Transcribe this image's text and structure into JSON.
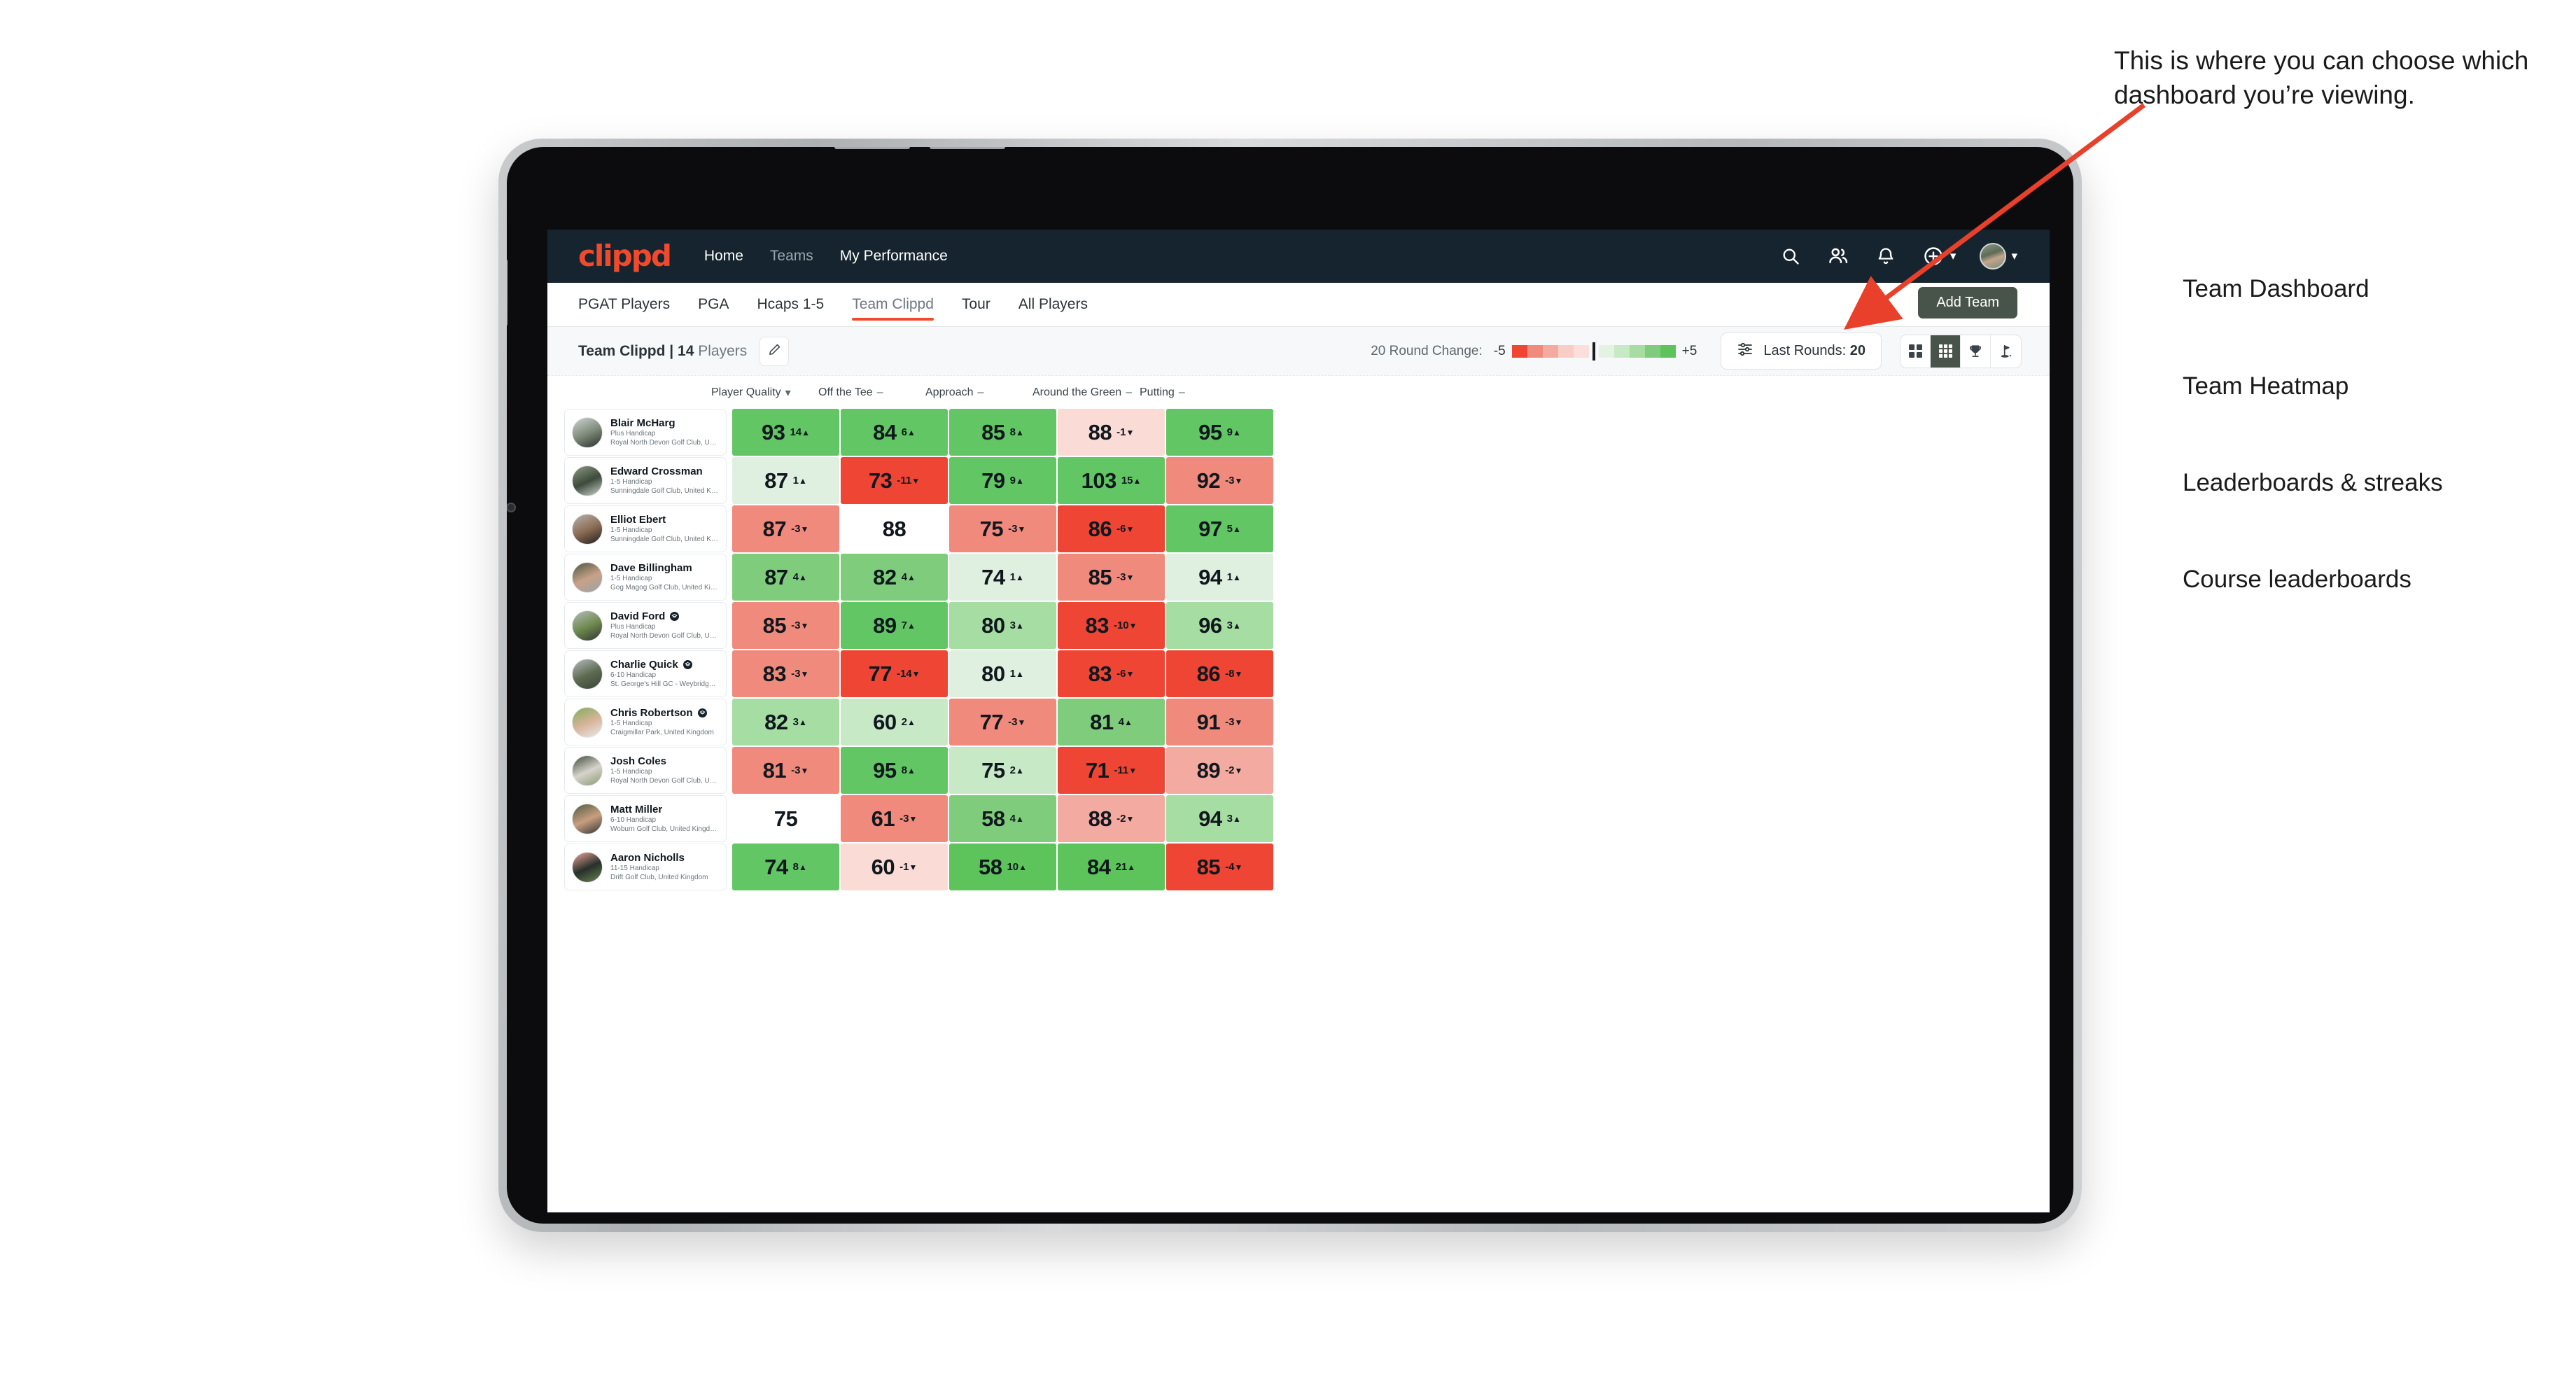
{
  "navbar": {
    "logo": "clippd",
    "links": [
      {
        "label": "Home",
        "dim": false
      },
      {
        "label": "Teams",
        "dim": true
      },
      {
        "label": "My Performance",
        "dim": false
      }
    ],
    "icons": [
      "search-icon",
      "people-icon",
      "bell-icon",
      "plus-circle-icon",
      "avatar"
    ]
  },
  "tabs": [
    {
      "label": "PGAT Players",
      "active": false
    },
    {
      "label": "PGA",
      "active": false
    },
    {
      "label": "Hcaps 1-5",
      "active": false
    },
    {
      "label": "Team Clippd",
      "active": true
    },
    {
      "label": "Tour",
      "active": false
    },
    {
      "label": "All Players",
      "active": false
    }
  ],
  "add_team_label": "Add Team",
  "toolbar": {
    "team_name": "Team Clippd",
    "separator": "|",
    "player_count": "14",
    "players_word": "Players",
    "edit_icon": "pencil-icon",
    "legend_label": "20 Round Change:",
    "legend_min": "-5",
    "legend_max": "+5",
    "rounds_icon": "filter-sliders-icon",
    "rounds_label": "Last Rounds:",
    "rounds_value": "20",
    "view_toggle": [
      {
        "name": "team-dashboard",
        "icon": "grid-4-icon",
        "active": false
      },
      {
        "name": "team-heatmap",
        "icon": "grid-9-icon",
        "active": true
      },
      {
        "name": "leaderboards-streaks",
        "icon": "trophy-icon",
        "active": false
      },
      {
        "name": "course-leaderboards",
        "icon": "golf-flag-icon",
        "active": false
      }
    ]
  },
  "columns": [
    {
      "label": "Player Quality",
      "marker": "chevron-down-icon"
    },
    {
      "label": "Off the Tee",
      "marker": "dash"
    },
    {
      "label": "Approach",
      "marker": "dash"
    },
    {
      "label": "Around the Green",
      "marker": "dash"
    },
    {
      "label": "Putting",
      "marker": "dash"
    }
  ],
  "chart_data": {
    "type": "heatmap",
    "title": "Team Clippd | 14 Players",
    "columns": [
      "Player Quality",
      "Off the Tee",
      "Approach",
      "Around the Green",
      "Putting"
    ],
    "rows": [
      "Blair McHarg",
      "Edward Crossman",
      "Elliot Ebert",
      "Dave Billingham",
      "David Ford",
      "Charlie Quick",
      "Chris Robertson",
      "Josh Coles",
      "Matt Miller",
      "Aaron Nicholls"
    ],
    "values": [
      [
        93,
        84,
        85,
        88,
        95
      ],
      [
        87,
        73,
        79,
        103,
        92
      ],
      [
        87,
        88,
        75,
        86,
        97
      ],
      [
        87,
        82,
        74,
        85,
        94
      ],
      [
        85,
        89,
        80,
        83,
        96
      ],
      [
        83,
        77,
        80,
        83,
        86
      ],
      [
        82,
        60,
        77,
        81,
        91
      ],
      [
        81,
        95,
        75,
        71,
        89
      ],
      [
        75,
        61,
        58,
        88,
        94
      ],
      [
        74,
        60,
        58,
        84,
        85
      ]
    ],
    "deltas": [
      [
        14,
        6,
        8,
        -1,
        9
      ],
      [
        1,
        -11,
        9,
        15,
        -3
      ],
      [
        -3,
        null,
        -3,
        -6,
        5
      ],
      [
        4,
        4,
        1,
        -3,
        1
      ],
      [
        -3,
        7,
        3,
        -10,
        3
      ],
      [
        -3,
        -14,
        1,
        -6,
        -8
      ],
      [
        3,
        2,
        -3,
        4,
        -3
      ],
      [
        -3,
        8,
        2,
        -11,
        -2
      ],
      [
        null,
        -3,
        4,
        -2,
        3
      ],
      [
        8,
        -1,
        10,
        21,
        -4
      ]
    ],
    "legend": {
      "min": -5,
      "max": 5,
      "label": "20 Round Change"
    },
    "colorscale": [
      "#ee4535",
      "#f08a7d",
      "#f3aaa0",
      "#f8cdc6",
      "#fbdfda",
      "#ffffff",
      "#e4f2e4",
      "#c8e9c6",
      "#a5dda2",
      "#7fcd7c",
      "#5cc45b"
    ]
  },
  "players": [
    {
      "name": "Blair McHarg",
      "verified": false,
      "handicap": "Plus Handicap",
      "club": "Royal North Devon Golf Club, United Kingdom",
      "avatar_colors": [
        "#cfd4d6",
        "#7e8a78",
        "#2a2f2c"
      ],
      "cells": [
        {
          "value": "93",
          "delta": "14",
          "dir": "up",
          "bg": "#62c665"
        },
        {
          "value": "84",
          "delta": "6",
          "dir": "up",
          "bg": "#62c665"
        },
        {
          "value": "85",
          "delta": "8",
          "dir": "up",
          "bg": "#62c665"
        },
        {
          "value": "88",
          "delta": "-1",
          "dir": "down",
          "bg": "#fadbd5"
        },
        {
          "value": "95",
          "delta": "9",
          "dir": "up",
          "bg": "#62c665"
        }
      ]
    },
    {
      "name": "Edward Crossman",
      "verified": false,
      "handicap": "1-5 Handicap",
      "club": "Sunningdale Golf Club, United Kingdom",
      "avatar_colors": [
        "#8f9b85",
        "#3d4a3c",
        "#d0d6cf"
      ],
      "cells": [
        {
          "value": "87",
          "delta": "1",
          "dir": "up",
          "bg": "#dff0e0"
        },
        {
          "value": "73",
          "delta": "-11",
          "dir": "down",
          "bg": "#ee4535"
        },
        {
          "value": "79",
          "delta": "9",
          "dir": "up",
          "bg": "#62c665"
        },
        {
          "value": "103",
          "delta": "15",
          "dir": "up",
          "bg": "#62c665"
        },
        {
          "value": "92",
          "delta": "-3",
          "dir": "down",
          "bg": "#f08a7d"
        }
      ]
    },
    {
      "name": "Elliot Ebert",
      "verified": false,
      "handicap": "1-5 Handicap",
      "club": "Sunningdale Golf Club, United Kingdom",
      "avatar_colors": [
        "#b9b3ad",
        "#8b6c55",
        "#1e1d1b"
      ],
      "cells": [
        {
          "value": "87",
          "delta": "-3",
          "dir": "down",
          "bg": "#f08a7d"
        },
        {
          "value": "88",
          "delta": "",
          "dir": "none",
          "bg": "#ffffff"
        },
        {
          "value": "75",
          "delta": "-3",
          "dir": "down",
          "bg": "#f08a7d"
        },
        {
          "value": "86",
          "delta": "-6",
          "dir": "down",
          "bg": "#ee4535"
        },
        {
          "value": "97",
          "delta": "5",
          "dir": "up",
          "bg": "#62c665"
        }
      ]
    },
    {
      "name": "Dave Billingham",
      "verified": false,
      "handicap": "1-5 Handicap",
      "club": "Gog Magog Golf Club, United Kingdom",
      "avatar_colors": [
        "#4a5442",
        "#c8a187",
        "#9aa3a8"
      ],
      "cells": [
        {
          "value": "87",
          "delta": "4",
          "dir": "up",
          "bg": "#7fcd7c"
        },
        {
          "value": "82",
          "delta": "4",
          "dir": "up",
          "bg": "#7fcd7c"
        },
        {
          "value": "74",
          "delta": "1",
          "dir": "up",
          "bg": "#dff0e0"
        },
        {
          "value": "85",
          "delta": "-3",
          "dir": "down",
          "bg": "#f08a7d"
        },
        {
          "value": "94",
          "delta": "1",
          "dir": "up",
          "bg": "#dff0e0"
        }
      ]
    },
    {
      "name": "David Ford",
      "verified": true,
      "handicap": "Plus Handicap",
      "club": "Royal North Devon Golf Club, United Kingdom",
      "avatar_colors": [
        "#b6bcbe",
        "#6f8a4e",
        "#2f3433"
      ],
      "cells": [
        {
          "value": "85",
          "delta": "-3",
          "dir": "down",
          "bg": "#f08a7d"
        },
        {
          "value": "89",
          "delta": "7",
          "dir": "up",
          "bg": "#62c665"
        },
        {
          "value": "80",
          "delta": "3",
          "dir": "up",
          "bg": "#a5dda2"
        },
        {
          "value": "83",
          "delta": "-10",
          "dir": "down",
          "bg": "#ee4535"
        },
        {
          "value": "96",
          "delta": "3",
          "dir": "up",
          "bg": "#a5dda2"
        }
      ]
    },
    {
      "name": "Charlie Quick",
      "verified": true,
      "handicap": "6-10 Handicap",
      "club": "St. George's Hill GC - Weybridge - Surrey, Uni...",
      "avatar_colors": [
        "#b6bcc0",
        "#5e6b52",
        "#3a4238"
      ],
      "cells": [
        {
          "value": "83",
          "delta": "-3",
          "dir": "down",
          "bg": "#f08a7d"
        },
        {
          "value": "77",
          "delta": "-14",
          "dir": "down",
          "bg": "#ee4535"
        },
        {
          "value": "80",
          "delta": "1",
          "dir": "up",
          "bg": "#dff0e0"
        },
        {
          "value": "83",
          "delta": "-6",
          "dir": "down",
          "bg": "#ee4535"
        },
        {
          "value": "86",
          "delta": "-8",
          "dir": "down",
          "bg": "#ee4535"
        }
      ]
    },
    {
      "name": "Chris Robertson",
      "verified": true,
      "handicap": "1-5 Handicap",
      "club": "Craigmillar Park, United Kingdom",
      "avatar_colors": [
        "#7fae5a",
        "#d8b49a",
        "#e8eaea"
      ],
      "cells": [
        {
          "value": "82",
          "delta": "3",
          "dir": "up",
          "bg": "#a5dda2"
        },
        {
          "value": "60",
          "delta": "2",
          "dir": "up",
          "bg": "#c8e9c6"
        },
        {
          "value": "77",
          "delta": "-3",
          "dir": "down",
          "bg": "#f08a7d"
        },
        {
          "value": "81",
          "delta": "4",
          "dir": "up",
          "bg": "#7fcd7c"
        },
        {
          "value": "91",
          "delta": "-3",
          "dir": "down",
          "bg": "#f08a7d"
        }
      ]
    },
    {
      "name": "Josh Coles",
      "verified": false,
      "handicap": "1-5 Handicap",
      "club": "Royal North Devon Golf Club, United Kingdom",
      "avatar_colors": [
        "#3e4a37",
        "#d7d3cd",
        "#8a9a6e"
      ],
      "cells": [
        {
          "value": "81",
          "delta": "-3",
          "dir": "down",
          "bg": "#f08a7d"
        },
        {
          "value": "95",
          "delta": "8",
          "dir": "up",
          "bg": "#62c665"
        },
        {
          "value": "75",
          "delta": "2",
          "dir": "up",
          "bg": "#c8e9c6"
        },
        {
          "value": "71",
          "delta": "-11",
          "dir": "down",
          "bg": "#ee4535"
        },
        {
          "value": "89",
          "delta": "-2",
          "dir": "down",
          "bg": "#f3aaa0"
        }
      ]
    },
    {
      "name": "Matt Miller",
      "verified": false,
      "handicap": "6-10 Handicap",
      "club": "Woburn Golf Club, United Kingdom",
      "avatar_colors": [
        "#4d5a42",
        "#c99e80",
        "#2e3530"
      ],
      "cells": [
        {
          "value": "75",
          "delta": "",
          "dir": "none",
          "bg": "#ffffff"
        },
        {
          "value": "61",
          "delta": "-3",
          "dir": "down",
          "bg": "#f08a7d"
        },
        {
          "value": "58",
          "delta": "4",
          "dir": "up",
          "bg": "#7fcd7c"
        },
        {
          "value": "88",
          "delta": "-2",
          "dir": "down",
          "bg": "#f3aaa0"
        },
        {
          "value": "94",
          "delta": "3",
          "dir": "up",
          "bg": "#a5dda2"
        }
      ]
    },
    {
      "name": "Aaron Nicholls",
      "verified": false,
      "handicap": "11-15 Handicap",
      "club": "Drift Golf Club, United Kingdom",
      "avatar_colors": [
        "#f0a89a",
        "#26302a",
        "#6d8552"
      ],
      "cells": [
        {
          "value": "74",
          "delta": "8",
          "dir": "up",
          "bg": "#62c665"
        },
        {
          "value": "60",
          "delta": "-1",
          "dir": "down",
          "bg": "#fadbd5"
        },
        {
          "value": "58",
          "delta": "10",
          "dir": "up",
          "bg": "#5cc45b"
        },
        {
          "value": "84",
          "delta": "21",
          "dir": "up",
          "bg": "#5cc45b"
        },
        {
          "value": "85",
          "delta": "-4",
          "dir": "down",
          "bg": "#ee4535"
        }
      ]
    }
  ],
  "annotation": {
    "callout": "This is where you can choose which dashboard you’re viewing.",
    "items": [
      "Team Dashboard",
      "Team Heatmap",
      "Leaderboards & streaks",
      "Course leaderboards"
    ],
    "arrow_color": "#e8402a"
  }
}
